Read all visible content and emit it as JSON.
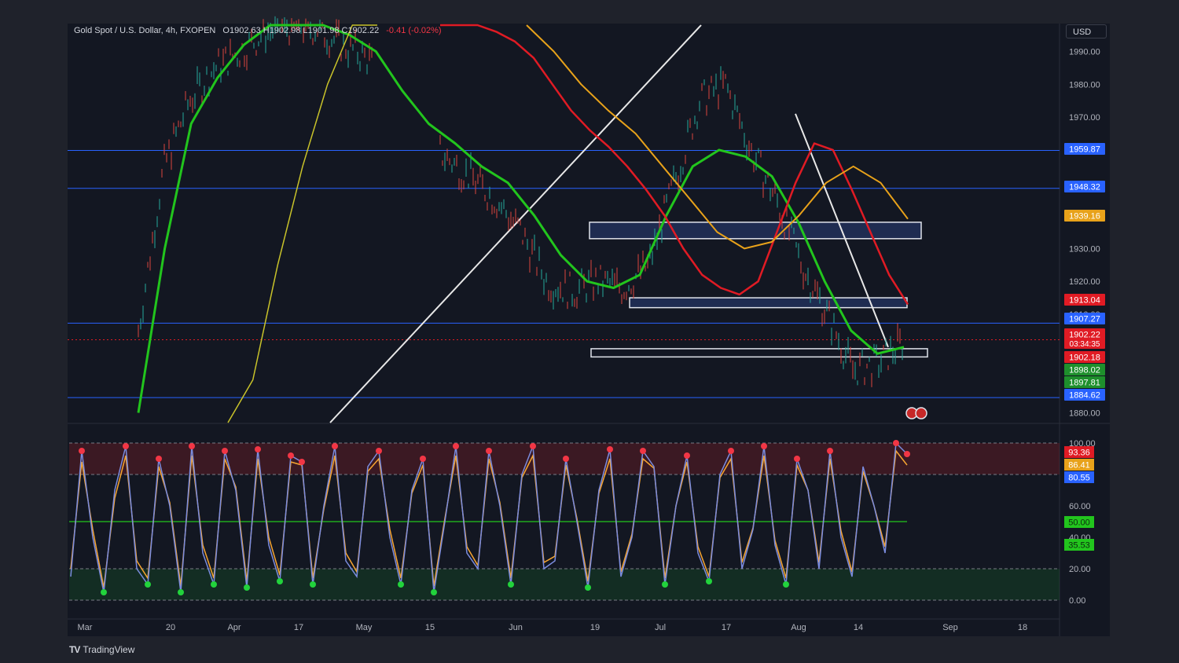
{
  "header": {
    "symbol": "Gold Spot / U.S. Dollar, 4h, FXOPEN",
    "ohlc": "O1902.63 H1902.98 L1901.98 C1902.22",
    "change": "-0.41 (-0.02%)"
  },
  "currency": "USD",
  "branding": "TradingView",
  "colors": {
    "background": "#131722",
    "green_ma": "#22c51d",
    "red_ma": "#e01b24",
    "orange_ma": "#e8a21a",
    "yellow_ma": "#c9c32a",
    "level_line": "#2962ff",
    "stoch_k": "#7b8cde",
    "stoch_d": "#f7a531"
  },
  "chart_data": [
    {
      "type": "line",
      "title": "Gold Spot / U.S. Dollar, 4h, FXOPEN",
      "ylabel": "USD",
      "ylim": [
        1877,
        1998
      ],
      "x_ticks": [
        "Mar",
        "20",
        "Apr",
        "17",
        "May",
        "15",
        "Jun",
        "19",
        "Jul",
        "17",
        "Aug",
        "14",
        "Sep",
        "18"
      ],
      "y_ticks": [
        "1990.00",
        "1980.00",
        "1970.00",
        "1930.00",
        "1920.00",
        "1910.00",
        "1880.00"
      ],
      "price_tags": [
        {
          "value": "1959.87",
          "color": "#2962ff"
        },
        {
          "value": "1948.32",
          "color": "#2962ff"
        },
        {
          "value": "1939.16",
          "color": "#e8a21a"
        },
        {
          "value": "1913.04",
          "color": "#e01b24"
        },
        {
          "value": "1907.27",
          "color": "#2962ff"
        },
        {
          "value": "1902.22",
          "color": "#e01b24",
          "countdown": "03:34:35"
        },
        {
          "value": "1902.18",
          "color": "#e01b24"
        },
        {
          "value": "1898.02",
          "color": "#1e8f2c"
        },
        {
          "value": "1897.81",
          "color": "#1e8f2c"
        },
        {
          "value": "1884.62",
          "color": "#2962ff"
        }
      ],
      "horizontal_levels": [
        1959.87,
        1948.32,
        1907.27,
        1884.62
      ],
      "last_price": 1902.22,
      "zones": [
        {
          "from": 1933,
          "to": 1938
        },
        {
          "from": 1912,
          "to": 1915
        },
        {
          "from": 1897,
          "to": 1899.5
        }
      ],
      "series": [
        {
          "values": [
            1905,
            1955,
            1975,
            1985,
            1990,
            1996,
            1998,
            1997,
            1992,
            1988,
            1975,
            1965,
            1958,
            1952,
            1945,
            1935,
            1920,
            1917,
            1920,
            1918,
            1925,
            1950,
            1975,
            1980,
            1960,
            1945,
            1925,
            1910,
            1893,
            1895,
            1902
          ]
        },
        {
          "values": [
            1880,
            1930,
            1968,
            1982,
            1992,
            1998,
            1998,
            1998,
            1995,
            1990,
            1978,
            1968,
            1962,
            1955,
            1950,
            1940,
            1928,
            1920,
            1918,
            1922,
            1940,
            1955,
            1960,
            1958,
            1952,
            1938,
            1920,
            1905,
            1898,
            1900
          ]
        },
        {
          "values": [
            2000,
            2000,
            1998,
            1996,
            1993,
            1988,
            1980,
            1972,
            1966,
            1961,
            1955,
            1948,
            1940,
            1930,
            1922,
            1918,
            1916,
            1920,
            1935,
            1950,
            1962,
            1960,
            1948,
            1935,
            1922,
            1913
          ]
        },
        {
          "values": [
            2000,
            1990,
            1980,
            1972,
            1965,
            1955,
            1945,
            1935,
            1930,
            1932,
            1940,
            1950,
            1955,
            1950,
            1939
          ]
        },
        {
          "values": [
            1860,
            1890,
            1925,
            1955,
            1980,
            1998,
            2000
          ]
        }
      ]
    },
    {
      "type": "line",
      "title": "Stochastic",
      "ylim": [
        0,
        100
      ],
      "y_ticks": [
        "100.00",
        "60.00",
        "40.00",
        "20.00",
        "0.00"
      ],
      "bands": [
        20,
        50,
        80,
        100
      ],
      "price_tags": [
        {
          "value": "93.36",
          "color": "#e01b24"
        },
        {
          "value": "86.41",
          "color": "#e8a21a"
        },
        {
          "value": "80.55",
          "color": "#2962ff"
        },
        {
          "value": "50.00",
          "color": "#22c51d"
        },
        {
          "value": "35.53",
          "color": "#22c51d"
        }
      ],
      "series": [
        {
          "values": [
            15,
            95,
            40,
            5,
            70,
            98,
            20,
            10,
            90,
            60,
            5,
            98,
            30,
            10,
            95,
            70,
            8,
            96,
            35,
            12,
            92,
            88,
            10,
            60,
            98,
            25,
            15,
            85,
            95,
            40,
            10,
            70,
            90,
            5,
            50,
            98,
            30,
            20,
            95,
            60,
            10,
            80,
            98,
            20,
            25,
            90,
            50,
            8,
            70,
            96,
            15,
            40,
            95,
            85,
            10,
            60,
            92,
            30,
            12,
            80,
            95,
            20,
            45,
            98,
            35,
            10,
            90,
            70,
            20,
            95,
            40,
            15,
            85,
            60,
            30,
            100,
            93
          ]
        },
        {
          "values": [
            20,
            88,
            45,
            8,
            65,
            92,
            25,
            14,
            85,
            62,
            9,
            92,
            35,
            14,
            90,
            72,
            12,
            90,
            40,
            16,
            88,
            86,
            14,
            58,
            92,
            30,
            18,
            82,
            90,
            45,
            14,
            68,
            86,
            9,
            52,
            92,
            34,
            22,
            90,
            62,
            14,
            78,
            92,
            24,
            28,
            86,
            52,
            12,
            68,
            90,
            18,
            42,
            90,
            84,
            14,
            60,
            88,
            34,
            15,
            78,
            90,
            24,
            46,
            92,
            38,
            14,
            86,
            70,
            24,
            90,
            44,
            18,
            82,
            60,
            34,
            95,
            86
          ]
        }
      ]
    }
  ]
}
